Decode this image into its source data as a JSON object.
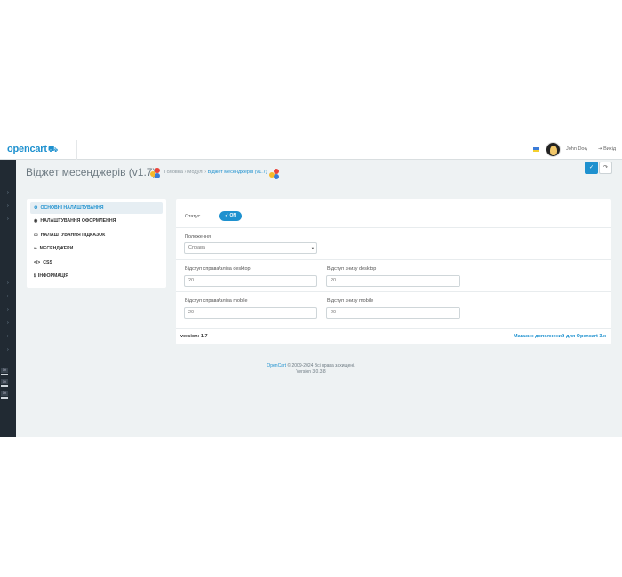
{
  "header": {
    "logo_text": "opencart",
    "logo_cart_glyph": "⛟",
    "user_name": "John Doe",
    "logout_label": "Вихід",
    "flag_colors": [
      "#3b7bd8",
      "#f4cf2e"
    ]
  },
  "sidebar": {
    "chips": [
      "Dit",
      "Dit",
      "Dit"
    ]
  },
  "page": {
    "title": "Віджет месенджерів (v1.7)",
    "breadcrumb": [
      "Головна",
      "Модулі",
      "Віджет месенджерів (v1.7)"
    ],
    "breadcrumb_separator": "›",
    "save_button_icon": "✓",
    "back_button_icon": "↷"
  },
  "menu": {
    "items": [
      {
        "label": "ОСНОВНІ НАЛАШТУВАННЯ",
        "icon": "gear-icon",
        "glyph": "⚙",
        "active": true
      },
      {
        "label": "НАЛАШТУВАННЯ ОФОРМЛЕННЯ",
        "icon": "eye-icon",
        "glyph": "◉",
        "active": false
      },
      {
        "label": "НАЛАШТУВАННЯ ПІДКАЗОК",
        "icon": "comment-icon",
        "glyph": "▭",
        "active": false
      },
      {
        "label": "МЕСЕНДЖЕРИ",
        "icon": "link-icon",
        "glyph": "∞",
        "active": false
      },
      {
        "label": "CSS",
        "icon": "code-icon",
        "glyph": "</>",
        "active": false
      },
      {
        "label": "ІНФОРМАЦІЯ",
        "icon": "info-icon",
        "glyph": "ℹ",
        "active": false
      }
    ]
  },
  "form": {
    "status_label": "Статус",
    "status_value": "✓ ON",
    "position_label": "Положення",
    "position_value": "Справа",
    "offset_desktop_side_label": "Відступ справа/зліва desktop",
    "offset_desktop_side_value": "20",
    "offset_desktop_bottom_label": "Відступ знизу desktop",
    "offset_desktop_bottom_value": "20",
    "offset_mobile_side_label": "Відступ справа/зліва mobile",
    "offset_mobile_side_value": "20",
    "offset_mobile_bottom_label": "Відступ знизу mobile",
    "offset_mobile_bottom_value": "20",
    "version": "version: 1.7",
    "shop_link": "Магазин дополнений для Opencart 3.x"
  },
  "footer": {
    "brand": "OpenCart",
    "copyright": "© 2009-2024 Всі права захищені.",
    "version": "Version 3.0.3.8"
  },
  "colors": {
    "accent": "#1e91cf",
    "sidebar": "#212a33",
    "background": "#eef2f3"
  }
}
